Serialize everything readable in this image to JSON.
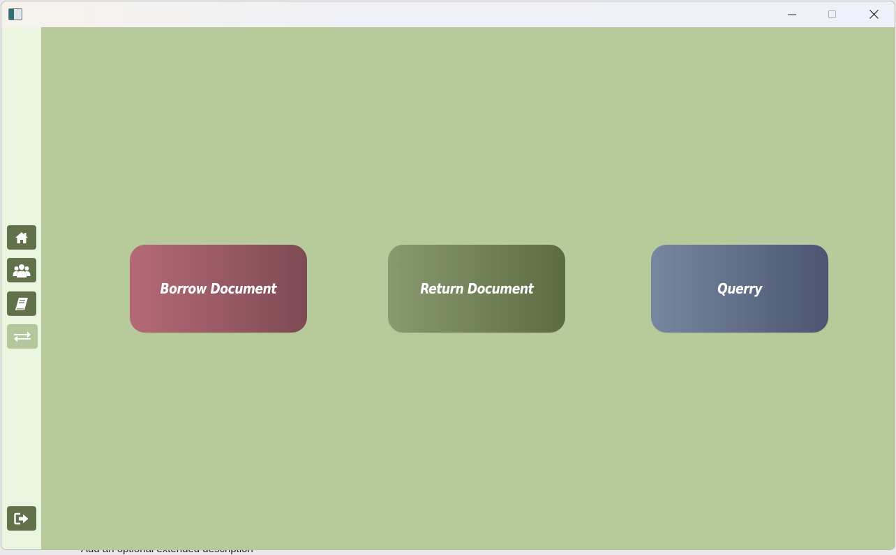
{
  "window": {
    "minimize_label": "Minimize",
    "maximize_label": "Maximize",
    "close_label": "Close"
  },
  "sidebar": {
    "items": [
      {
        "name": "home",
        "icon": "home-icon"
      },
      {
        "name": "users",
        "icon": "users-icon"
      },
      {
        "name": "documents",
        "icon": "book-icon"
      },
      {
        "name": "transactions",
        "icon": "exchange-icon",
        "active": true
      }
    ],
    "logout": {
      "icon": "logout-icon"
    }
  },
  "main": {
    "cards": [
      {
        "label": "Borrow Document",
        "color_start": "#b46a76",
        "color_end": "#7f4a53"
      },
      {
        "label": "Return Document",
        "color_start": "#8a9a70",
        "color_end": "#5c6b42"
      },
      {
        "label": "Querry",
        "color_start": "#77879f",
        "color_end": "#4a5672"
      }
    ]
  },
  "backdrop": {
    "text": "Add an optional extended description"
  },
  "colors": {
    "background": "#b7ca9b",
    "sidebar": "#eaf5df",
    "sidebar_button": "#61714a",
    "sidebar_button_active": "#b3c79a"
  }
}
